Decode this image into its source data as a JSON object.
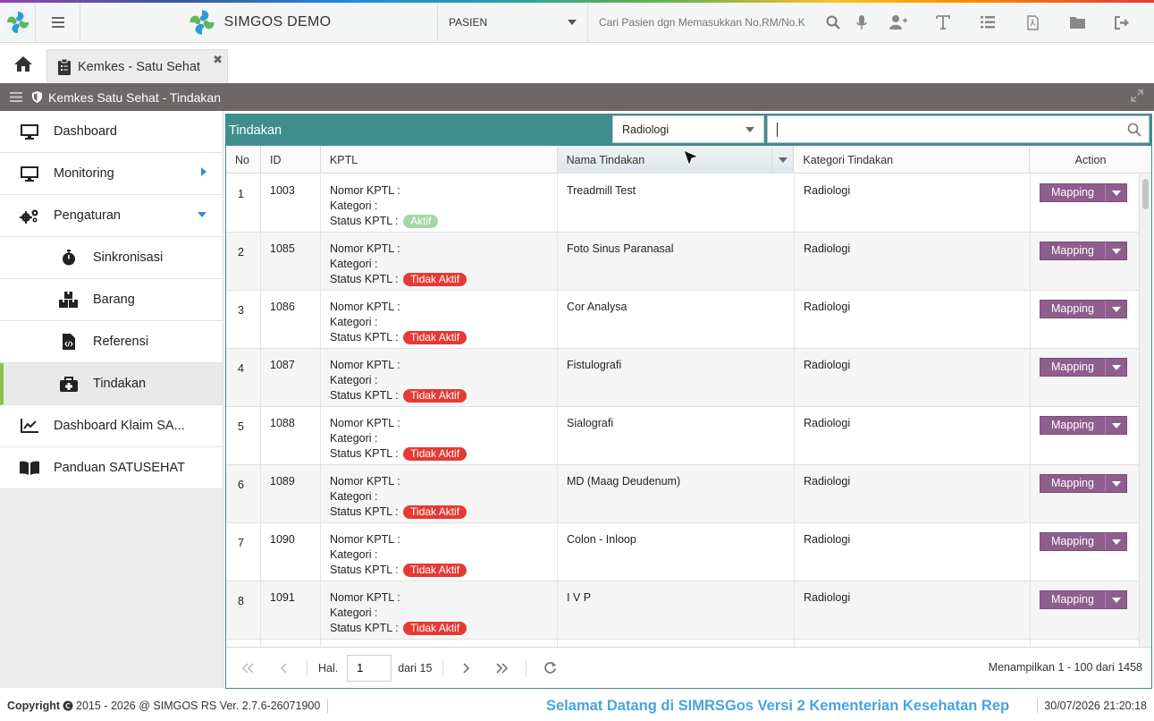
{
  "header": {
    "app_name": "SIMGOS DEMO",
    "patient_select": "PASIEN",
    "search_placeholder": "Cari Pasien dgn Memasukkan No.RM/No.K"
  },
  "tabs": [
    {
      "label": "Kemkes - Satu Sehat",
      "close": "✖"
    }
  ],
  "section_title": "Kemkes Satu Sehat - Tindakan",
  "sidebar": {
    "items": [
      {
        "label": "Dashboard"
      },
      {
        "label": "Monitoring"
      },
      {
        "label": "Pengaturan"
      },
      {
        "label": "Sinkronisasi"
      },
      {
        "label": "Barang"
      },
      {
        "label": "Referensi"
      },
      {
        "label": "Tindakan"
      },
      {
        "label": "Dashboard Klaim SA..."
      },
      {
        "label": "Panduan SATUSEHAT"
      }
    ]
  },
  "panel": {
    "title": "Tindakan",
    "filter_value": "Radiologi",
    "search_value": ""
  },
  "grid": {
    "columns": [
      "No",
      "ID",
      "KPTL",
      "Nama Tindakan",
      "Kategori Tindakan",
      "Action"
    ],
    "kptl_labels": {
      "nomor": "Nomor KPTL :",
      "kategori": "Kategori :",
      "status": "Status KPTL :"
    },
    "action_label": "Mapping",
    "rows": [
      {
        "no": "1",
        "id": "1003",
        "status": "Aktif",
        "nama": "Treadmill Test",
        "kategori": "Radiologi"
      },
      {
        "no": "2",
        "id": "1085",
        "status": "Tidak Aktif",
        "nama": "Foto Sinus Paranasal",
        "kategori": "Radiologi"
      },
      {
        "no": "3",
        "id": "1086",
        "status": "Tidak Aktif",
        "nama": "Cor Analysa",
        "kategori": "Radiologi"
      },
      {
        "no": "4",
        "id": "1087",
        "status": "Tidak Aktif",
        "nama": "Fistulografi",
        "kategori": "Radiologi"
      },
      {
        "no": "5",
        "id": "1088",
        "status": "Tidak Aktif",
        "nama": "Sialografi",
        "kategori": "Radiologi"
      },
      {
        "no": "6",
        "id": "1089",
        "status": "Tidak Aktif",
        "nama": "MD (Maag Deudenum)",
        "kategori": "Radiologi"
      },
      {
        "no": "7",
        "id": "1090",
        "status": "Tidak Aktif",
        "nama": "Colon - Inloop",
        "kategori": "Radiologi"
      },
      {
        "no": "8",
        "id": "1091",
        "status": "Tidak Aktif",
        "nama": "I V P",
        "kategori": "Radiologi"
      }
    ]
  },
  "pager": {
    "page_label": "Hal.",
    "page_value": "1",
    "page_total": "dari 15",
    "info": "Menampilkan 1 - 100 dari 1458"
  },
  "footer": {
    "copyright_label": "Copyright",
    "copyright_text": "2015 - 2026 @ SIMGOS RS Ver. 2.7.6-26071900",
    "marquee": "Selamat Datang di SIMRSGos Versi 2 Kementerian Kesehatan Rep",
    "datetime": "30/07/2026 21:20:18"
  },
  "colors": {
    "teal": "#3f8e8e",
    "mapping_button": "#8e5e8e",
    "badge_active": "#a5d6a7",
    "badge_inactive": "#e53935",
    "active_indicator": "#8bc34a"
  }
}
